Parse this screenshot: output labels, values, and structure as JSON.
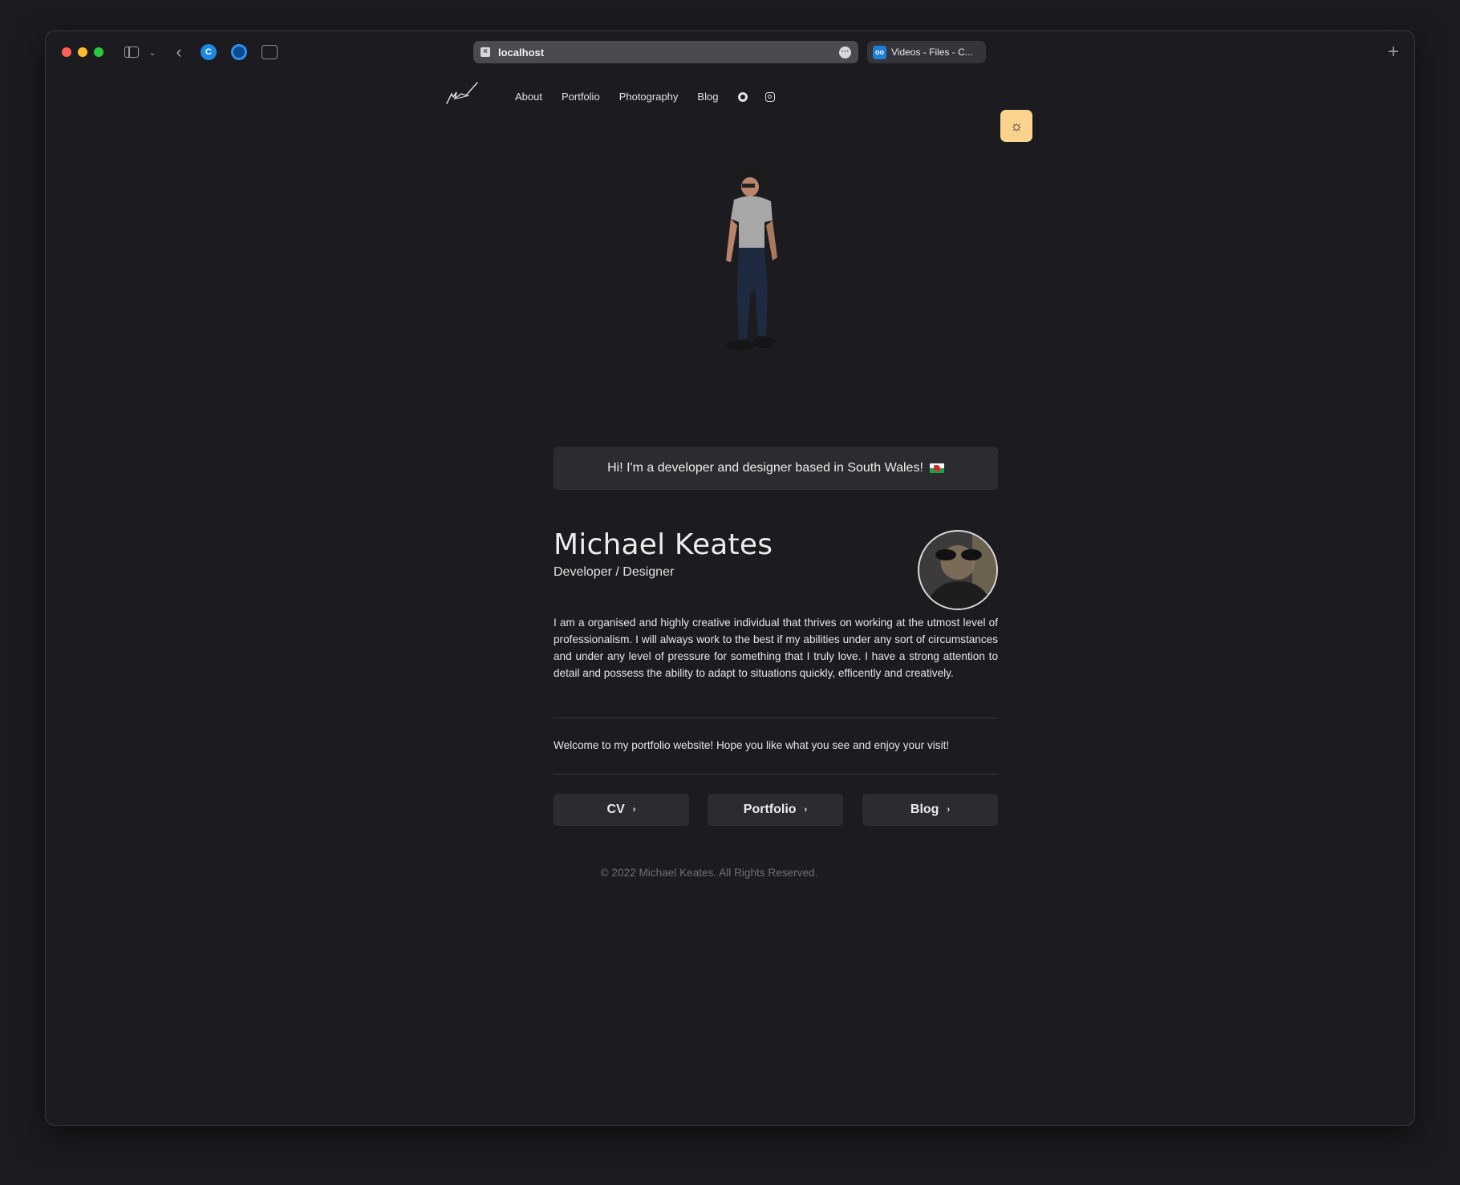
{
  "browser": {
    "url": "localhost",
    "other_tab": "Videos - Files - C..."
  },
  "nav": {
    "links": [
      "About",
      "Portfolio",
      "Photography",
      "Blog"
    ],
    "icons": [
      "github-icon",
      "instagram-icon"
    ],
    "theme_toggle_icon": "sun-icon",
    "theme_toggle_color": "#fbd38d"
  },
  "intro": {
    "text": "Hi! I'm a developer and designer based in South Wales!",
    "flag": "welsh-flag-emoji"
  },
  "profile": {
    "name": "Michael Keates",
    "role": "Developer / Designer"
  },
  "bio": "I am a organised and highly creative individual that thrives on working at the utmost level of professionalism. I will always work to the best if my abilities under any sort of circumstances and under any level of pressure for something that I truly love. I have a strong attention to detail and possess the ability to adapt to situations quickly, efficently and creatively.",
  "welcome": "Welcome to my portfolio website! Hope you like what you see and enjoy your visit!",
  "buttons": {
    "cv": "CV",
    "portfolio": "Portfolio",
    "blog": "Blog"
  },
  "footer": "© 2022 Michael Keates. All Rights Reserved."
}
